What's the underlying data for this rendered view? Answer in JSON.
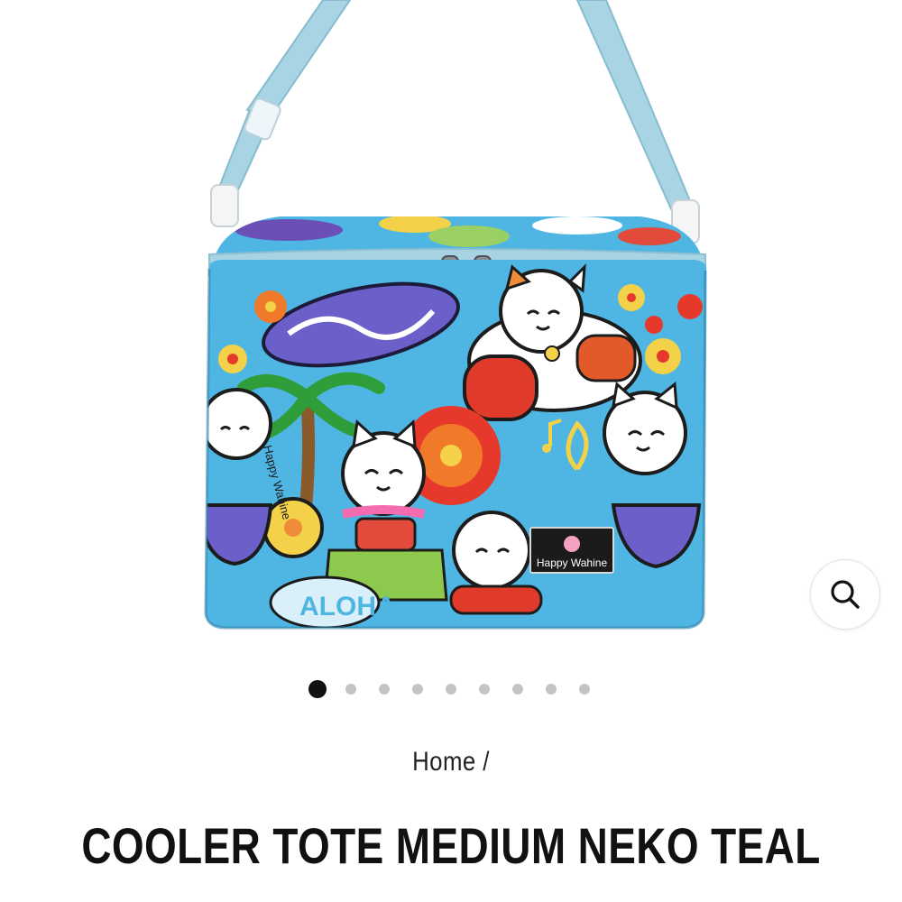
{
  "gallery": {
    "image_alt": "Cooler tote with lucky cat pattern",
    "logo_text": "Happy Wahine",
    "logo_text_vertical": "Happy Wahine",
    "aloha_text": "ALOHA",
    "dot_count": 9,
    "active_index": 0
  },
  "zoom": {
    "icon": "search-icon"
  },
  "breadcrumb": {
    "home": "Home",
    "separator": "/"
  },
  "product": {
    "title": "COOLER TOTE MEDIUM NEKO TEAL"
  },
  "colors": {
    "bag_blue": "#4fb6e3",
    "strap": "#a7d3e3",
    "active_dot": "#111111",
    "inactive_dot": "#c4c4c4"
  }
}
